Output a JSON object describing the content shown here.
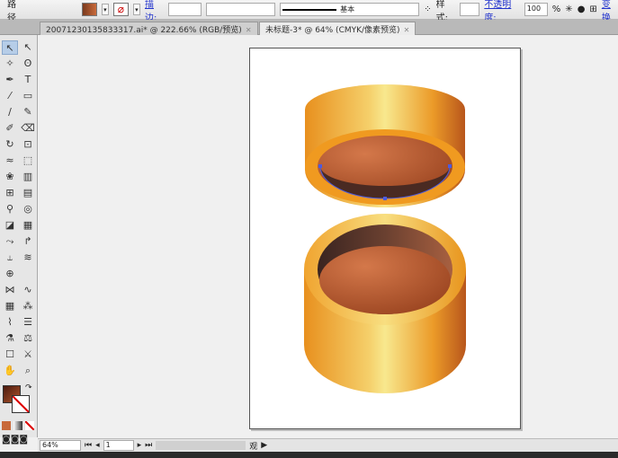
{
  "control_bar": {
    "object_type": "路径",
    "stroke_label": "描边:",
    "stroke_weight": "",
    "brush": "基本",
    "style_label": "样式:",
    "opacity_label": "不透明度:",
    "opacity_value": "100",
    "opacity_unit": "%",
    "transform_label": "变换"
  },
  "tabs": [
    {
      "label": "20071230135833317.ai* @ 222.66% (RGB/预览)",
      "active": false
    },
    {
      "label": "未标题-3* @ 64% (CMYK/像素预览)",
      "active": true
    }
  ],
  "tools": [
    [
      "selection",
      "↖"
    ],
    [
      "direct-selection",
      "↖"
    ],
    [
      "magic-wand",
      "✧"
    ],
    [
      "lasso",
      "ʘ"
    ],
    [
      "pen",
      "✒"
    ],
    [
      "type",
      "T"
    ],
    [
      "line",
      "⁄"
    ],
    [
      "rectangle",
      "▭"
    ],
    [
      "paintbrush",
      "∕"
    ],
    [
      "pencil",
      "✎"
    ],
    [
      "blob-brush",
      "✐"
    ],
    [
      "eraser",
      "⌫"
    ],
    [
      "rotate",
      "↻"
    ],
    [
      "scale",
      "⊡"
    ],
    [
      "warp",
      "≈"
    ],
    [
      "free-transform",
      "⬚"
    ],
    [
      "symbol-sprayer",
      "❀"
    ],
    [
      "column-graph",
      "▥"
    ],
    [
      "mesh",
      "⊞"
    ],
    [
      "gradient",
      "▤"
    ],
    [
      "eyedropper",
      "⚲"
    ],
    [
      "blend",
      "◎"
    ],
    [
      "live-paint",
      "◪"
    ],
    [
      "bar-graph",
      "▦"
    ],
    [
      "red-tool",
      "⤳"
    ],
    [
      "red-tool-2",
      "↱"
    ],
    [
      "blue-tool",
      "⥿"
    ],
    [
      "green-tool",
      "≋"
    ],
    [
      "crosshair",
      "⊕"
    ],
    [
      "envelope",
      "⋈"
    ],
    [
      "wave",
      "∿"
    ],
    [
      "grid",
      "▦"
    ],
    [
      "dots",
      "⁂"
    ],
    [
      "path",
      "⌇"
    ],
    [
      "list",
      "☰"
    ],
    [
      "dropper",
      "⚗"
    ],
    [
      "measure",
      "⚖"
    ],
    [
      "crop",
      "☐"
    ],
    [
      "knife",
      "⚔"
    ],
    [
      "hand",
      "✋"
    ],
    [
      "zoom",
      "⌕"
    ]
  ],
  "fill_color": "#7a3a1e",
  "stroke_color": "none",
  "status": {
    "zoom": "64%",
    "page": "1",
    "text": "观"
  },
  "colors": {
    "gold_light": "#f5e98a",
    "orange": "#e8901e",
    "brown_inner": "#c0653a",
    "rim_dark": "#4a2a22"
  }
}
